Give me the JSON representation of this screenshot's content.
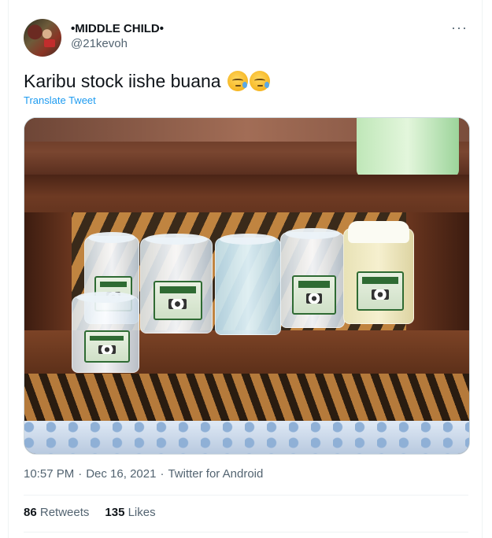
{
  "tweet": {
    "display_name": "•MIDDLE CHILD•",
    "handle": "@21kevoh",
    "text": "Karibu stock iishe buana",
    "emojis": [
      "downcast-face-with-sweat-icon",
      "downcast-face-with-sweat-icon"
    ],
    "translate_label": "Translate Tweet",
    "time": "10:57 PM",
    "date": "Dec 16, 2021",
    "source": "Twitter for Android",
    "separator": "·",
    "more_icon": "···",
    "media_description": "photo-of-jars-on-wooden-shelf"
  },
  "stats": {
    "retweets_count": "86",
    "retweets_label": "Retweets",
    "likes_count": "135",
    "likes_label": "Likes"
  },
  "colors": {
    "link": "#1d9bf0",
    "secondary_text": "#536471",
    "primary_text": "#0f1419"
  }
}
